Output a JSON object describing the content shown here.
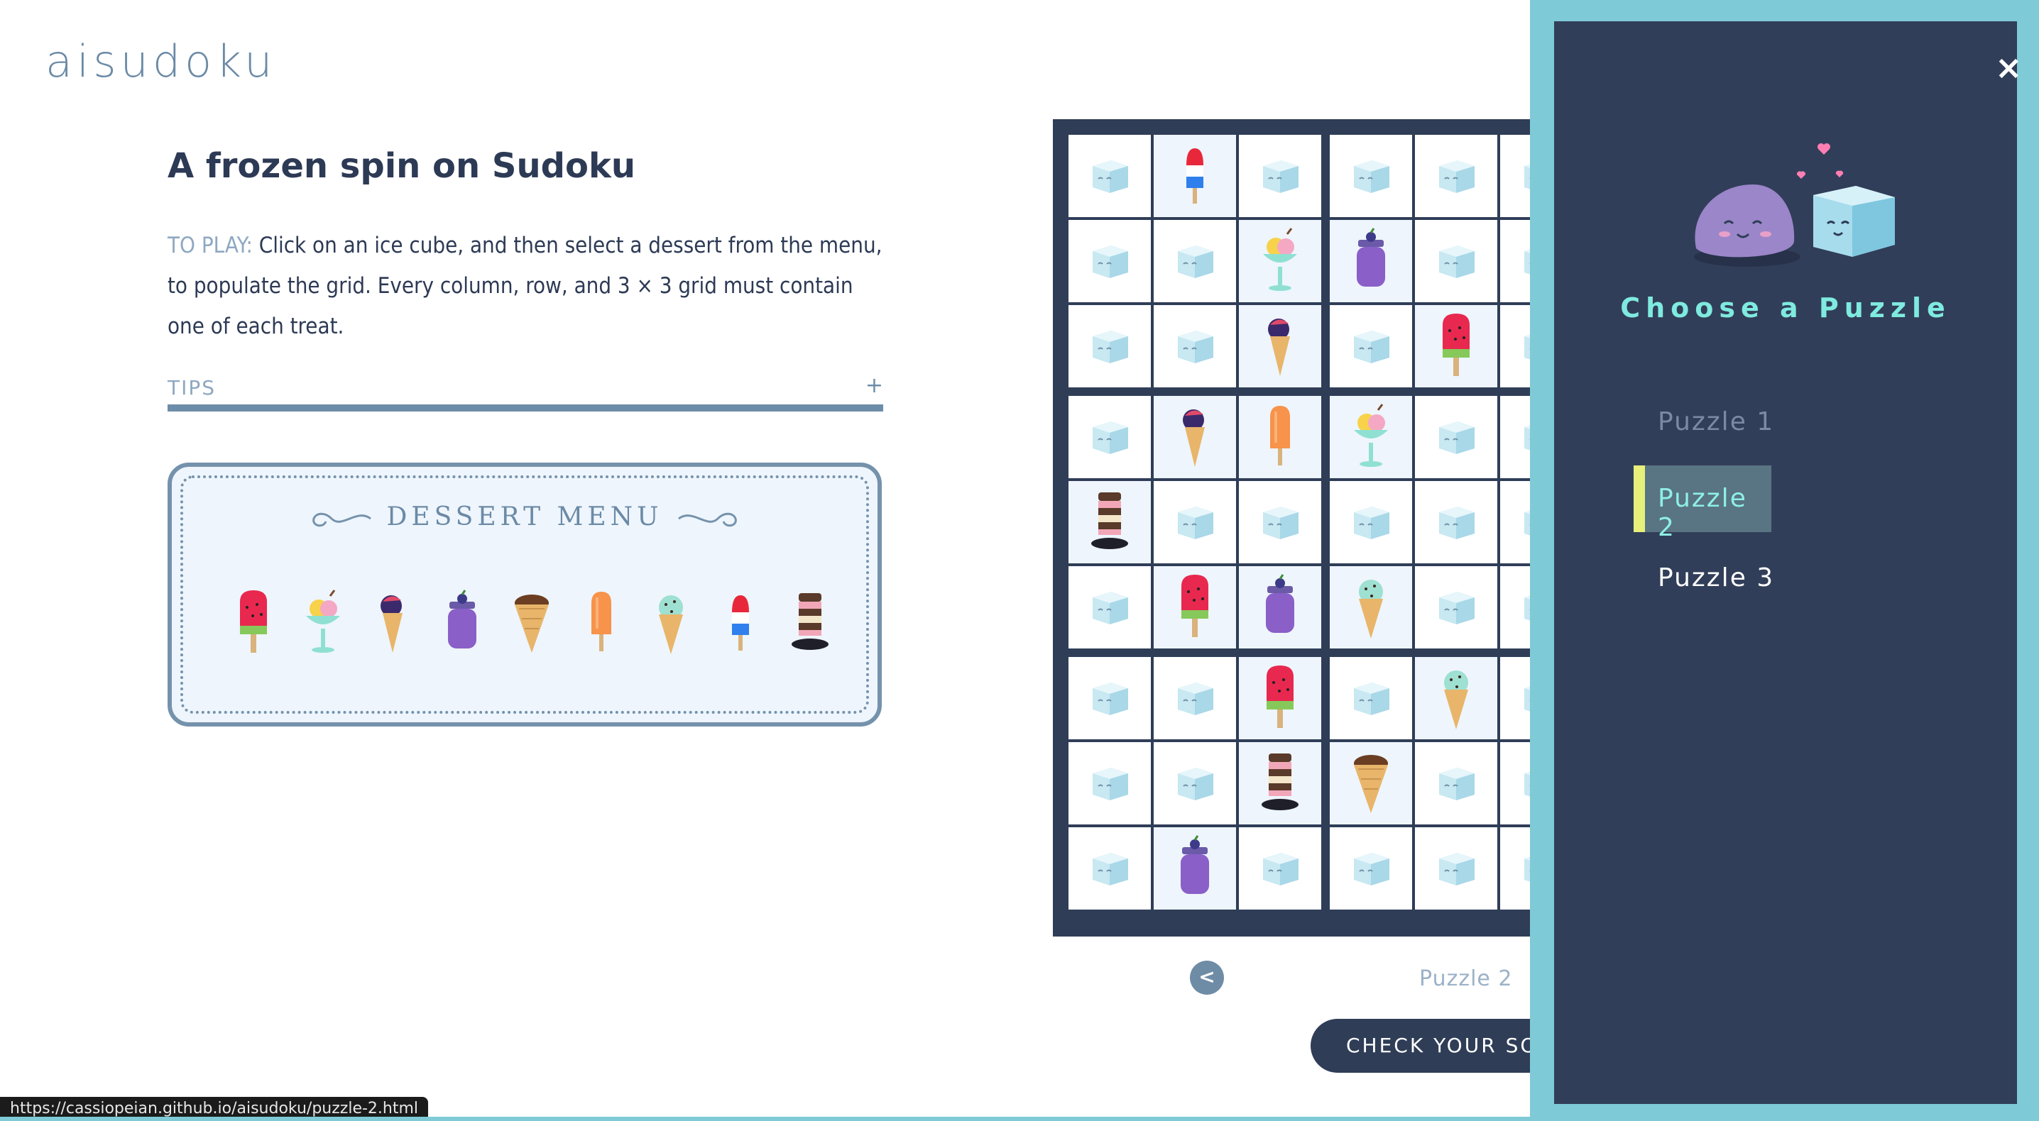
{
  "logo": "aisudoku",
  "header": {
    "title": "A frozen spin on Sudoku",
    "instructions_label": "TO PLAY:",
    "instructions_text": " Click on an ice cube, and then select a dessert from the menu, to populate the grid. Every column, row, and 3 × 3 grid must contain one of each treat."
  },
  "tips": {
    "label": "TIPS",
    "toggle": "+"
  },
  "menu": {
    "title": "DESSERT MENU",
    "items": [
      "watermelon-popsicle-icon",
      "sundae-icon",
      "berry-cone-icon",
      "smoothie-jar-icon",
      "chocolate-cone-icon",
      "orange-popsicle-icon",
      "mint-cone-icon",
      "rocket-popsicle-icon",
      "ice-cream-sandwich-stack-icon"
    ]
  },
  "board": {
    "visible_columns": 6,
    "rows": [
      [
        "ice",
        "rocket",
        "ice",
        "ice",
        "ice",
        "ice"
      ],
      [
        "ice",
        "ice",
        "sundae",
        "smoothie",
        "ice",
        "ice"
      ],
      [
        "ice",
        "ice",
        "berry",
        "ice",
        "watermelon",
        "ice"
      ],
      [
        "ice",
        "berry",
        "orange",
        "sundae",
        "ice",
        "ice"
      ],
      [
        "stack",
        "ice",
        "ice",
        "ice",
        "ice",
        "ice"
      ],
      [
        "ice",
        "watermelon",
        "smoothie",
        "mint",
        "ice",
        "ice"
      ],
      [
        "ice",
        "ice",
        "watermelon",
        "ice",
        "mint",
        "ice"
      ],
      [
        "ice",
        "ice",
        "stack",
        "choc",
        "ice",
        "ice"
      ],
      [
        "ice",
        "smoothie",
        "ice",
        "ice",
        "ice",
        "ice"
      ]
    ]
  },
  "footer": {
    "prev_label": "<",
    "puzzle_label": "Puzzle 2",
    "check_button": "CHECK YOUR SOLU"
  },
  "panel": {
    "close": "×",
    "title": "Choose a Puzzle",
    "puzzles": [
      "Puzzle 1",
      "Puzzle 2",
      "Puzzle 3"
    ],
    "active_index": 1
  },
  "status_bar": "https://cassiopeian.github.io/aisudoku/puzzle-2.html",
  "colors": {
    "navy": "#2f3d57",
    "panel": "#313e59",
    "teal": "#7ecad6",
    "mint": "#7feadf",
    "ice": "#c8e8f2"
  }
}
